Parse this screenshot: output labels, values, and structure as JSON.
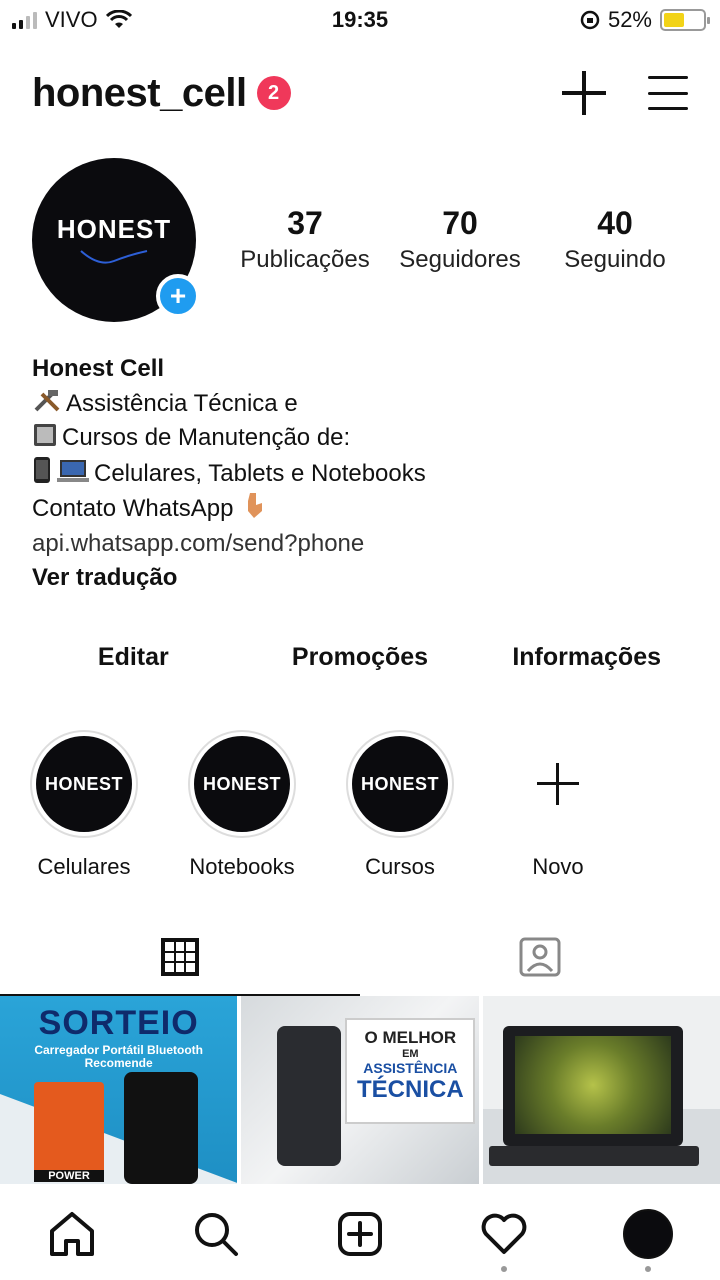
{
  "status_bar": {
    "carrier": "VIVO",
    "time": "19:35",
    "battery_percent": "52%",
    "battery_level": 0.52,
    "battery_color": "#f2d318"
  },
  "header": {
    "username": "honest_cell",
    "notification_count": "2",
    "icons": [
      "plus-icon",
      "menu-icon"
    ]
  },
  "profile": {
    "avatar_text": "HONEST",
    "stats": [
      {
        "value": "37",
        "label": "Publicações"
      },
      {
        "value": "70",
        "label": "Seguidores"
      },
      {
        "value": "40",
        "label": "Seguindo"
      }
    ],
    "bio": {
      "name": "Honest Cell",
      "line1": "Assistência Técnica e",
      "line2": "Cursos de Manutenção de:",
      "line3": "Celulares, Tablets e Notebooks",
      "line4": "Contato WhatsApp",
      "link": "api.whatsapp.com/send?phone",
      "translate": "Ver tradução"
    }
  },
  "actions": {
    "edit": "Editar",
    "promotions": "Promoções",
    "info": "Informações"
  },
  "highlights": [
    {
      "label": "Celulares",
      "cover_text": "HONEST"
    },
    {
      "label": "Notebooks",
      "cover_text": "HONEST"
    },
    {
      "label": "Cursos",
      "cover_text": "HONEST"
    },
    {
      "label": "Novo"
    }
  ],
  "posts": [
    {
      "title": "SORTEIO",
      "subtitle": "Carregador Portátil Bluetooth Recomende",
      "badge": "POWER"
    },
    {
      "line1": "O MELHOR",
      "line2": "EM",
      "line3": "ASSISTÊNCIA",
      "line4": "TÉCNICA"
    },
    {}
  ],
  "tabs": [
    "grid-icon",
    "tagged-icon"
  ],
  "bottom_nav": [
    "home-icon",
    "search-icon",
    "create-icon",
    "activity-icon",
    "profile-avatar"
  ],
  "colors": {
    "badge": "#f0385a",
    "add_story": "#1f9cf0",
    "avatar_bg": "#0b0b0e"
  }
}
